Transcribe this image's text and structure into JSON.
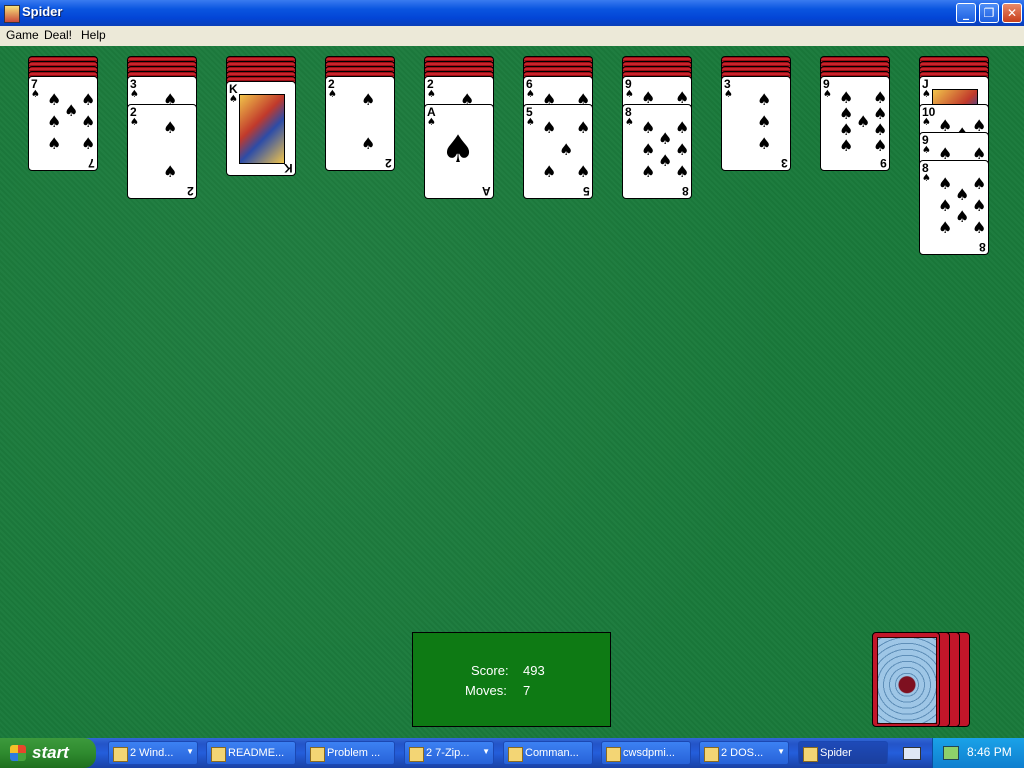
{
  "window": {
    "title": "Spider"
  },
  "menu": [
    "Game",
    "Deal!",
    "Help"
  ],
  "tableau": [
    {
      "hidden": 4,
      "faceup": [
        {
          "rank": "7",
          "suit": "spade"
        }
      ]
    },
    {
      "hidden": 4,
      "faceup": [
        {
          "rank": "3",
          "suit": "spade"
        },
        {
          "rank": "2",
          "suit": "spade"
        }
      ]
    },
    {
      "hidden": 5,
      "faceup": [
        {
          "rank": "K",
          "suit": "spade"
        }
      ]
    },
    {
      "hidden": 4,
      "faceup": [
        {
          "rank": "2",
          "suit": "spade"
        }
      ]
    },
    {
      "hidden": 4,
      "faceup": [
        {
          "rank": "2",
          "suit": "spade"
        },
        {
          "rank": "A",
          "suit": "spade"
        }
      ]
    },
    {
      "hidden": 4,
      "faceup": [
        {
          "rank": "6",
          "suit": "spade"
        },
        {
          "rank": "5",
          "suit": "spade"
        }
      ]
    },
    {
      "hidden": 4,
      "faceup": [
        {
          "rank": "9",
          "suit": "spade"
        },
        {
          "rank": "8",
          "suit": "spade"
        }
      ]
    },
    {
      "hidden": 4,
      "faceup": [
        {
          "rank": "3",
          "suit": "spade"
        }
      ]
    },
    {
      "hidden": 4,
      "faceup": [
        {
          "rank": "9",
          "suit": "spade"
        }
      ]
    },
    {
      "hidden": 4,
      "faceup": [
        {
          "rank": "J",
          "suit": "spade"
        },
        {
          "rank": "10",
          "suit": "spade"
        },
        {
          "rank": "9",
          "suit": "spade"
        },
        {
          "rank": "8",
          "suit": "spade"
        }
      ]
    }
  ],
  "score": {
    "score_label": "Score:",
    "score_value": "493",
    "moves_label": "Moves:",
    "moves_value": "7"
  },
  "stock": {
    "piles": 4
  },
  "taskbar": {
    "start_label": "start",
    "tasks": [
      {
        "label": "2 Wind...",
        "icon": "folder-icon",
        "grouped": true
      },
      {
        "label": "README...",
        "icon": "document-icon",
        "grouped": false
      },
      {
        "label": "Problem ...",
        "icon": "problem-icon",
        "grouped": false
      },
      {
        "label": "2 7-Zip...",
        "icon": "7zip-icon",
        "grouped": true
      },
      {
        "label": "Comman...",
        "icon": "command-prompt-icon",
        "grouped": false
      },
      {
        "label": "cwsdpmi...",
        "icon": "notepad-icon",
        "grouped": false
      },
      {
        "label": "2 DOS...",
        "icon": "dosbox-icon",
        "grouped": true
      },
      {
        "label": "Spider",
        "icon": "spider-icon",
        "grouped": false,
        "active": true
      }
    ],
    "clock": "8:46 PM"
  }
}
